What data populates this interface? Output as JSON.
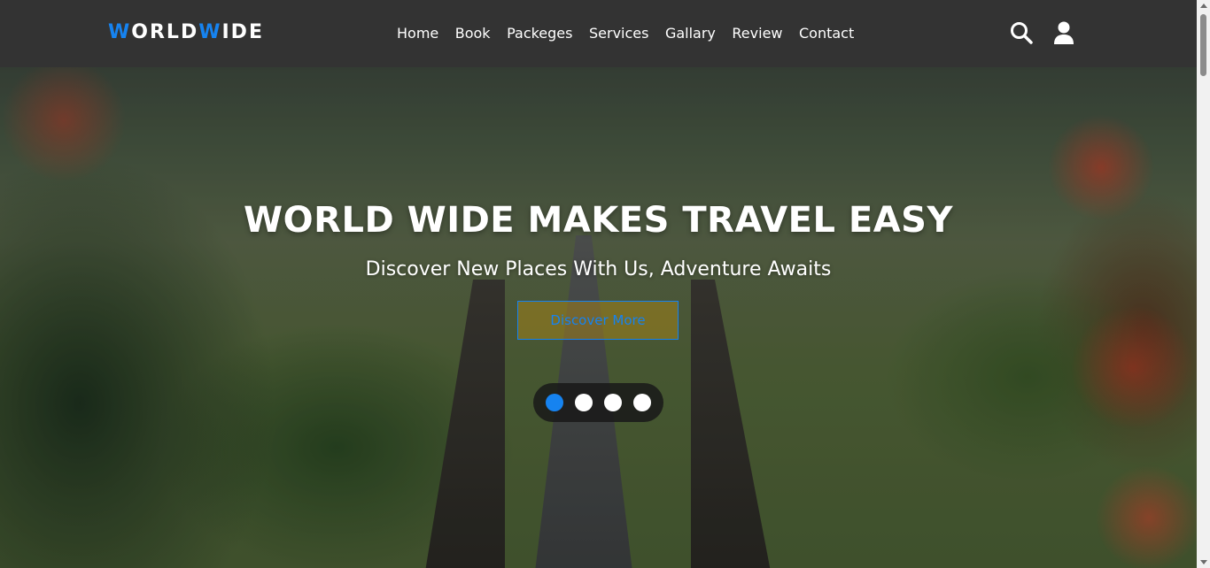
{
  "header": {
    "logo_part1_accent": "W",
    "logo_part2": "ORLD",
    "logo_part3_accent": "W",
    "logo_part4": "IDE",
    "nav": [
      "Home",
      "Book",
      "Packeges",
      "Services",
      "Gallary",
      "Review",
      "Contact"
    ],
    "icons": [
      "search-icon",
      "user-icon"
    ]
  },
  "hero": {
    "title": "WORLD WIDE MAKES TRAVEL EASY",
    "subtitle": "Discover New Places With Us, Adventure Awaits",
    "button_label": "Discover More",
    "slides_count": 4,
    "active_slide": 1
  },
  "colors": {
    "accent": "#1683f0",
    "header_bg": "#333333",
    "text": "#ffffff"
  }
}
